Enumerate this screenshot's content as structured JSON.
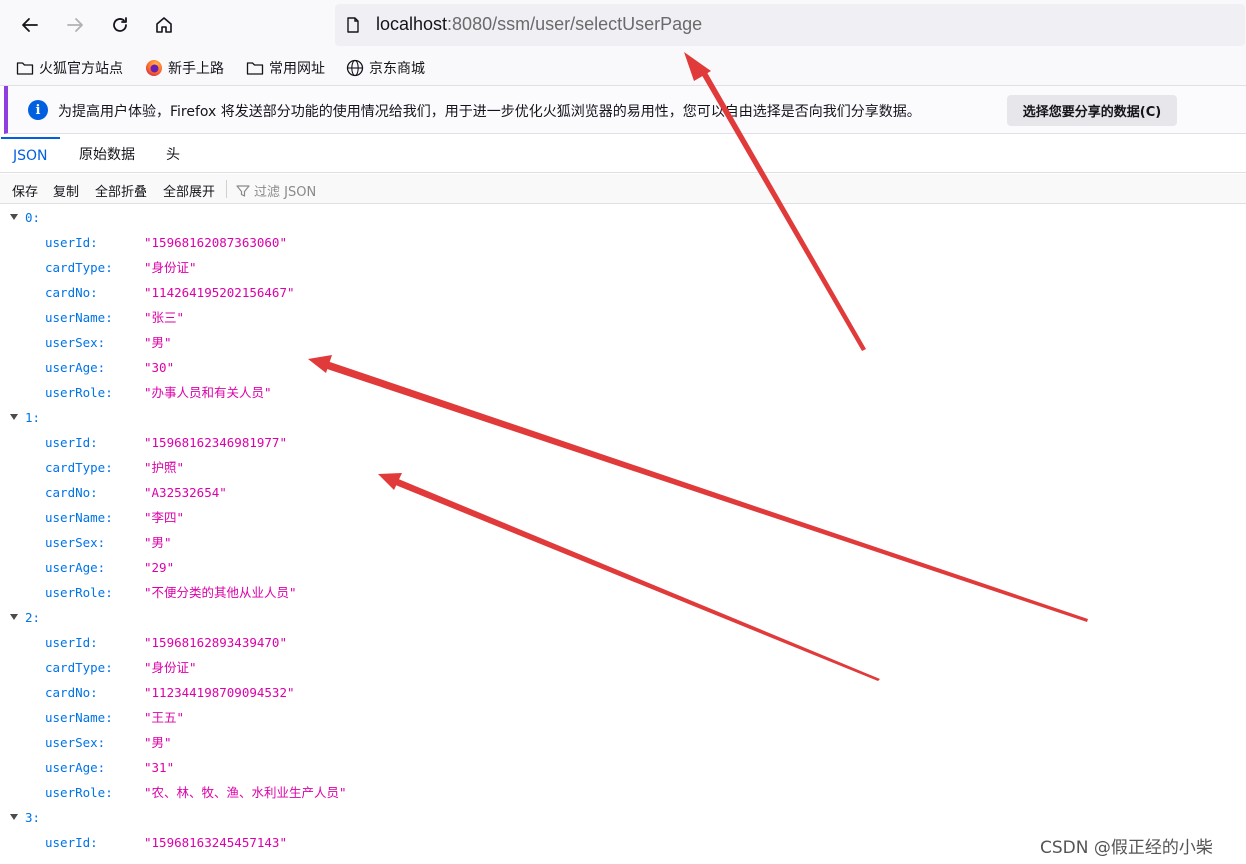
{
  "browser": {
    "url_host": "localhost",
    "url_rest": ":8080/ssm/user/selectUserPage"
  },
  "bookmarks": [
    {
      "label": "火狐官方站点",
      "icon": "folder-icon"
    },
    {
      "label": "新手上路",
      "icon": "firefox-icon"
    },
    {
      "label": "常用网址",
      "icon": "folder-icon"
    },
    {
      "label": "京东商城",
      "icon": "globe-icon"
    }
  ],
  "notification": {
    "text": "为提高用户体验，Firefox 将发送部分功能的使用情况给我们，用于进一步优化火狐浏览器的易用性，您可以自由选择是否向我们分享数据。",
    "button": "选择您要分享的数据(C)",
    "icon": "info-icon"
  },
  "viewer": {
    "tabs": [
      "JSON",
      "原始数据",
      "头"
    ],
    "toolbar": [
      "保存",
      "复制",
      "全部折叠",
      "全部展开"
    ],
    "filter_placeholder": "过滤 JSON"
  },
  "json": {
    "items": [
      {
        "index": "0:",
        "fields": [
          {
            "key": "userId:",
            "value": "\"15968162087363060\""
          },
          {
            "key": "cardType:",
            "value": "\"身份证\""
          },
          {
            "key": "cardNo:",
            "value": "\"114264195202156467\""
          },
          {
            "key": "userName:",
            "value": "\"张三\""
          },
          {
            "key": "userSex:",
            "value": "\"男\""
          },
          {
            "key": "userAge:",
            "value": "\"30\""
          },
          {
            "key": "userRole:",
            "value": "\"办事人员和有关人员\""
          }
        ]
      },
      {
        "index": "1:",
        "fields": [
          {
            "key": "userId:",
            "value": "\"15968162346981977\""
          },
          {
            "key": "cardType:",
            "value": "\"护照\""
          },
          {
            "key": "cardNo:",
            "value": "\"A32532654\""
          },
          {
            "key": "userName:",
            "value": "\"李四\""
          },
          {
            "key": "userSex:",
            "value": "\"男\""
          },
          {
            "key": "userAge:",
            "value": "\"29\""
          },
          {
            "key": "userRole:",
            "value": "\"不便分类的其他从业人员\""
          }
        ]
      },
      {
        "index": "2:",
        "fields": [
          {
            "key": "userId:",
            "value": "\"15968162893439470\""
          },
          {
            "key": "cardType:",
            "value": "\"身份证\""
          },
          {
            "key": "cardNo:",
            "value": "\"112344198709094532\""
          },
          {
            "key": "userName:",
            "value": "\"王五\""
          },
          {
            "key": "userSex:",
            "value": "\"男\""
          },
          {
            "key": "userAge:",
            "value": "\"31\""
          },
          {
            "key": "userRole:",
            "value": "\"农、林、牧、渔、水利业生产人员\""
          }
        ]
      },
      {
        "index": "3:",
        "fields": [
          {
            "key": "userId:",
            "value": "\"15968163245457143\""
          }
        ]
      }
    ]
  },
  "watermark": "CSDN @假正经的小柴",
  "colors": {
    "accent": "#0060df",
    "json_key": "#0074e8",
    "json_string": "#dd00a9",
    "annotation_arrow": "#e03a3a"
  }
}
